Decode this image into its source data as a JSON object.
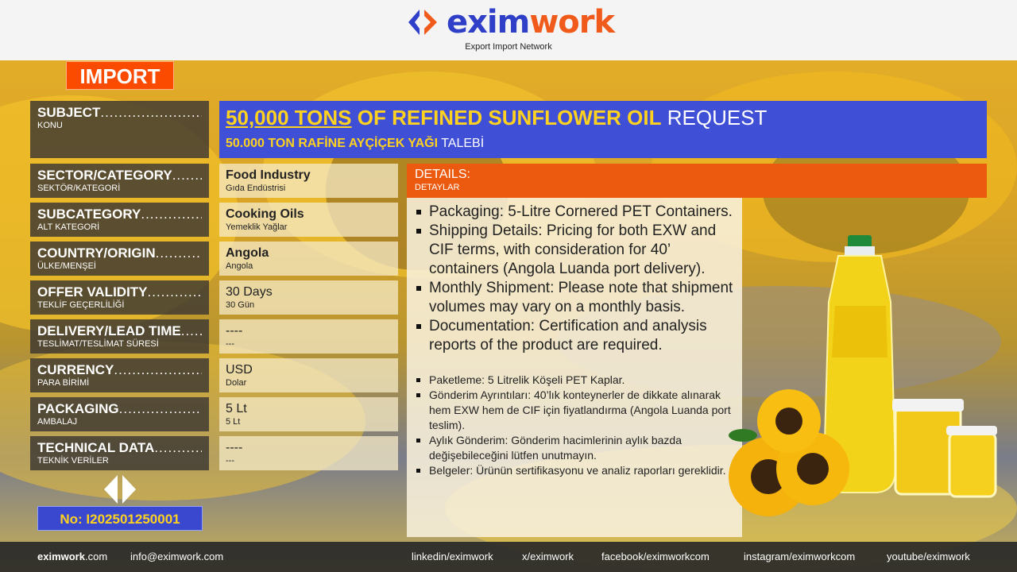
{
  "brand": {
    "name_part1": "exim",
    "name_part2": "work",
    "tagline": "Export Import Network",
    "color_blue": "#2f3fc8",
    "color_orange": "#f05a1a"
  },
  "import_badge": "IMPORT",
  "subject": {
    "label": "SUBJECT",
    "label_tr": "KONU",
    "title_highlight": "50,000 TONS",
    "title_mid": " OF REFINED SUNFLOWER OIL",
    "title_end": " REQUEST",
    "subtitle_highlight": "50.000 TON RAFİNE AYÇİÇEK YAĞI",
    "subtitle_end": " TALEBİ"
  },
  "rows": [
    {
      "label": "SECTOR/CATEGORY",
      "label_tr": "SEKTÖR/KATEGORİ",
      "value": "Food Industry",
      "value_tr": "Gıda Endüstrisi",
      "bold": true
    },
    {
      "label": "SUBCATEGORY",
      "label_tr": "ALT KATEGORİ",
      "value": "Cooking Oils",
      "value_tr": "Yemeklik Yağlar",
      "bold": true
    },
    {
      "label": "COUNTRY/ORIGIN",
      "label_tr": "ÜLKE/MENŞEİ",
      "value": "Angola",
      "value_tr": "Angola",
      "bold": true
    },
    {
      "label": "OFFER VALIDITY",
      "label_tr": "TEKLİF GEÇERLİLİĞİ",
      "value": "30 Days",
      "value_tr": "30 Gün",
      "bold": false
    },
    {
      "label": "DELIVERY/LEAD TIME",
      "label_tr": "TESLİMAT/TESLİMAT SÜRESİ",
      "value": "----",
      "value_tr": "---",
      "bold": false
    },
    {
      "label": "CURRENCY",
      "label_tr": "PARA BİRİMİ",
      "value": "USD",
      "value_tr": "Dolar",
      "bold": false
    },
    {
      "label": "PACKAGING",
      "label_tr": "AMBALAJ",
      "value": "5 Lt",
      "value_tr": "5 Lt",
      "bold": false
    },
    {
      "label": "TECHNICAL DATA",
      "label_tr": "TEKNİK VERİLER",
      "value": "----",
      "value_tr": "---",
      "bold": false
    }
  ],
  "details": {
    "label": "DETAILS",
    "label_tr": "DETAYLAR",
    "en": [
      "Packaging: 5-Litre Cornered PET Containers.",
      "Shipping Details: Pricing for both EXW and CIF terms, with consideration for 40’ containers (Angola Luanda port delivery).",
      "Monthly Shipment: Please note that shipment volumes may vary on a monthly basis.",
      "Documentation: Certification and analysis reports of the product are required."
    ],
    "tr": [
      "Paketleme: 5 Litrelik Köşeli PET Kaplar.",
      "Gönderim Ayrıntıları: 40’lık konteynerler de dikkate alınarak hem EXW hem de CIF için fiyatlandırma (Angola Luanda port teslim).",
      "Aylık Gönderim: Gönderim hacimlerinin aylık bazda değişebileceğini lütfen unutmayın.",
      "Belgeler: Ürünün sertifikasyonu ve analiz raporları gereklidir."
    ]
  },
  "reference_no": "No: I202501250001",
  "footer": {
    "site_bold": "eximwork",
    "site_rest": ".com",
    "email": "info@eximwork.com",
    "linkedin": "linkedin/eximwork",
    "x": "x/eximwork",
    "facebook": "facebook/eximworkcom",
    "instagram": "instagram/eximworkcom",
    "youtube": "youtube/eximwork"
  }
}
